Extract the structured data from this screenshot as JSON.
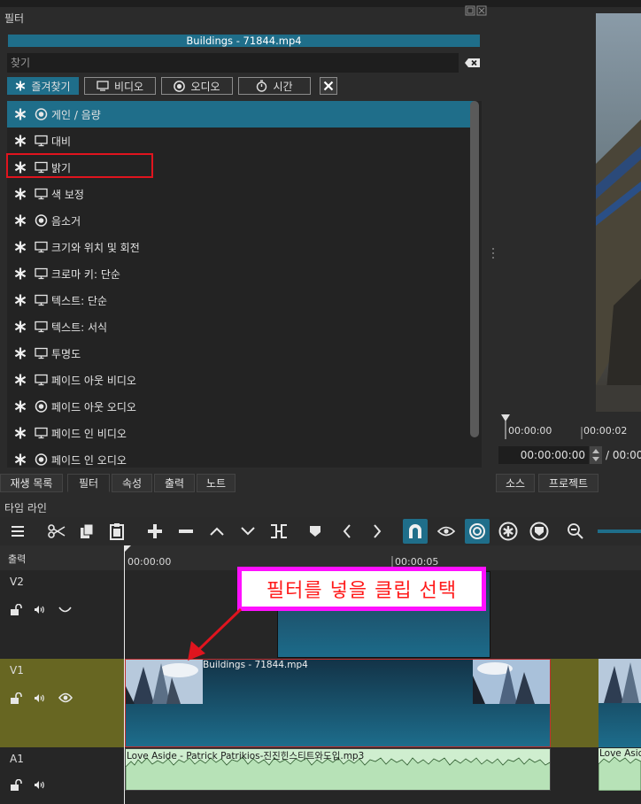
{
  "filter_panel": {
    "title": "필터",
    "clip_name": "Buildings - 71844.mp4",
    "search_placeholder": "찾기",
    "buttons": {
      "favorites": "즐겨찾기",
      "video": "비디오",
      "audio": "오디오",
      "time": "시간"
    },
    "filters": [
      {
        "label": "게인 / 음량",
        "type": "audio-icon",
        "selected": true
      },
      {
        "label": "대비",
        "type": "video-icon"
      },
      {
        "label": "밝기",
        "type": "video-icon",
        "highlighted": true
      },
      {
        "label": "색 보정",
        "type": "video-icon"
      },
      {
        "label": "음소거",
        "type": "audio-icon"
      },
      {
        "label": "크기와 위치 및 회전",
        "type": "video-icon"
      },
      {
        "label": "크로마 키: 단순",
        "type": "video-icon"
      },
      {
        "label": "텍스트: 단순",
        "type": "video-icon"
      },
      {
        "label": "텍스트: 서식",
        "type": "video-icon"
      },
      {
        "label": "투명도",
        "type": "video-icon"
      },
      {
        "label": "페이드 아웃 비디오",
        "type": "video-icon"
      },
      {
        "label": "페이드 아웃 오디오",
        "type": "audio-icon"
      },
      {
        "label": "페이드 인 비디오",
        "type": "video-icon"
      },
      {
        "label": "페이드 인 오디오",
        "type": "audio-icon"
      }
    ],
    "tabs": [
      "재생 목록",
      "필터",
      "속성",
      "출력",
      "노트"
    ]
  },
  "preview": {
    "ruler_ticks": [
      "00:00:00",
      "00:00:02"
    ],
    "timecode_current": "00:00:00:00",
    "timecode_total": "/ 00:00",
    "tabs": [
      "소스",
      "프로젝트"
    ]
  },
  "timeline": {
    "title": "타임 라인",
    "output_label": "출력",
    "ruler_ticks": [
      "00:00:00",
      "00:00:05"
    ],
    "tracks": {
      "v2": "V2",
      "v1": "V1",
      "a1": "A1"
    },
    "clips": {
      "v1_clip": "Buildings - 71844.mp4",
      "a1_clip": "Love Aside - Patrick Patrikios-진진힌스티트와도입.mp3",
      "a1_clip2": "Love Asic"
    }
  },
  "annotation": {
    "callout_text": "필터를 넣을 클립 선택",
    "callout_border": "#ff10ff",
    "callout_color": "#ff1a1a",
    "highlight_color": "#e0141e"
  },
  "colors": {
    "accent": "#1f6e8a",
    "panel": "#2b2b2b",
    "v1_track": "#676622",
    "audio_clip": "#cfeecf"
  }
}
